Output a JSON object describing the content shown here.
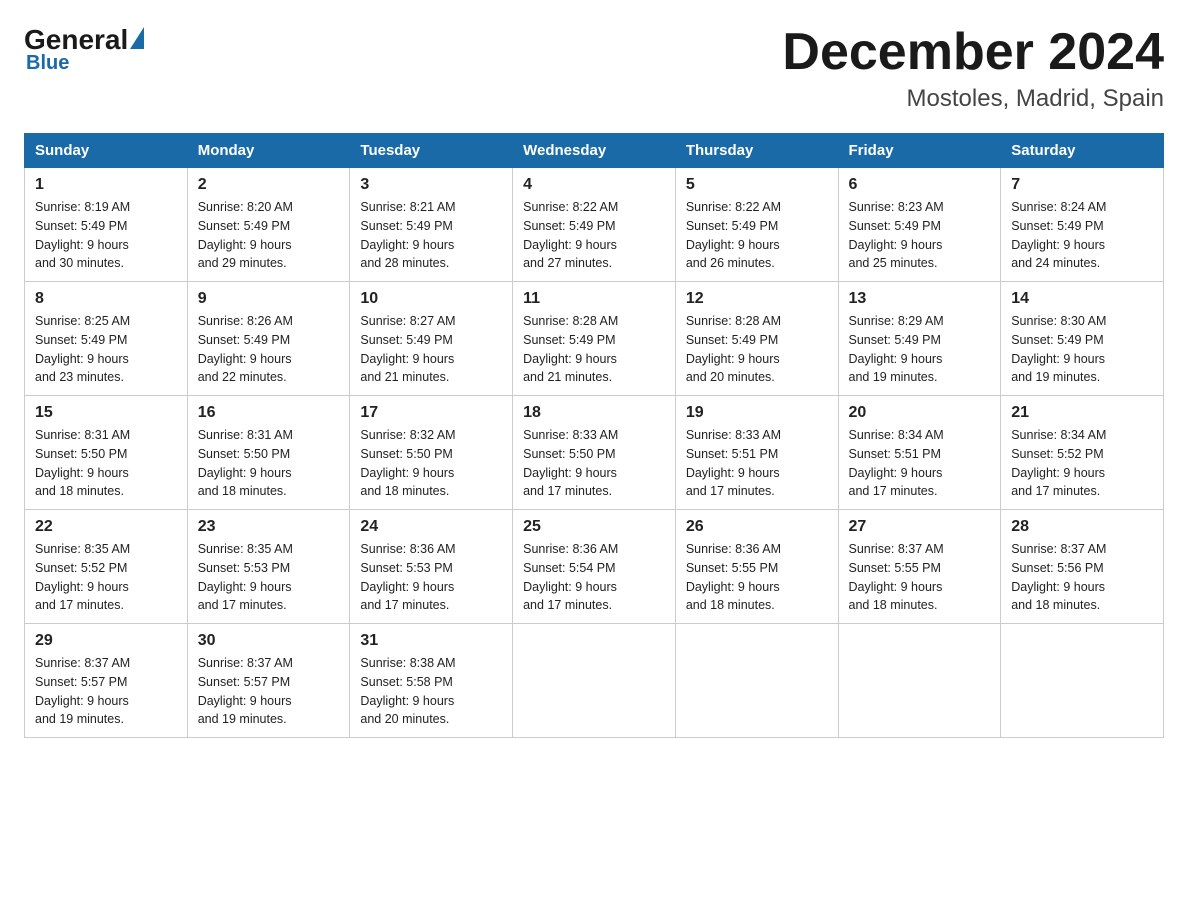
{
  "header": {
    "logo": {
      "general": "General",
      "blue": "Blue"
    },
    "title": "December 2024",
    "location": "Mostoles, Madrid, Spain"
  },
  "calendar": {
    "days_of_week": [
      "Sunday",
      "Monday",
      "Tuesday",
      "Wednesday",
      "Thursday",
      "Friday",
      "Saturday"
    ],
    "weeks": [
      [
        {
          "day": "1",
          "sunrise": "8:19 AM",
          "sunset": "5:49 PM",
          "daylight": "9 hours and 30 minutes."
        },
        {
          "day": "2",
          "sunrise": "8:20 AM",
          "sunset": "5:49 PM",
          "daylight": "9 hours and 29 minutes."
        },
        {
          "day": "3",
          "sunrise": "8:21 AM",
          "sunset": "5:49 PM",
          "daylight": "9 hours and 28 minutes."
        },
        {
          "day": "4",
          "sunrise": "8:22 AM",
          "sunset": "5:49 PM",
          "daylight": "9 hours and 27 minutes."
        },
        {
          "day": "5",
          "sunrise": "8:22 AM",
          "sunset": "5:49 PM",
          "daylight": "9 hours and 26 minutes."
        },
        {
          "day": "6",
          "sunrise": "8:23 AM",
          "sunset": "5:49 PM",
          "daylight": "9 hours and 25 minutes."
        },
        {
          "day": "7",
          "sunrise": "8:24 AM",
          "sunset": "5:49 PM",
          "daylight": "9 hours and 24 minutes."
        }
      ],
      [
        {
          "day": "8",
          "sunrise": "8:25 AM",
          "sunset": "5:49 PM",
          "daylight": "9 hours and 23 minutes."
        },
        {
          "day": "9",
          "sunrise": "8:26 AM",
          "sunset": "5:49 PM",
          "daylight": "9 hours and 22 minutes."
        },
        {
          "day": "10",
          "sunrise": "8:27 AM",
          "sunset": "5:49 PM",
          "daylight": "9 hours and 21 minutes."
        },
        {
          "day": "11",
          "sunrise": "8:28 AM",
          "sunset": "5:49 PM",
          "daylight": "9 hours and 21 minutes."
        },
        {
          "day": "12",
          "sunrise": "8:28 AM",
          "sunset": "5:49 PM",
          "daylight": "9 hours and 20 minutes."
        },
        {
          "day": "13",
          "sunrise": "8:29 AM",
          "sunset": "5:49 PM",
          "daylight": "9 hours and 19 minutes."
        },
        {
          "day": "14",
          "sunrise": "8:30 AM",
          "sunset": "5:49 PM",
          "daylight": "9 hours and 19 minutes."
        }
      ],
      [
        {
          "day": "15",
          "sunrise": "8:31 AM",
          "sunset": "5:50 PM",
          "daylight": "9 hours and 18 minutes."
        },
        {
          "day": "16",
          "sunrise": "8:31 AM",
          "sunset": "5:50 PM",
          "daylight": "9 hours and 18 minutes."
        },
        {
          "day": "17",
          "sunrise": "8:32 AM",
          "sunset": "5:50 PM",
          "daylight": "9 hours and 18 minutes."
        },
        {
          "day": "18",
          "sunrise": "8:33 AM",
          "sunset": "5:50 PM",
          "daylight": "9 hours and 17 minutes."
        },
        {
          "day": "19",
          "sunrise": "8:33 AM",
          "sunset": "5:51 PM",
          "daylight": "9 hours and 17 minutes."
        },
        {
          "day": "20",
          "sunrise": "8:34 AM",
          "sunset": "5:51 PM",
          "daylight": "9 hours and 17 minutes."
        },
        {
          "day": "21",
          "sunrise": "8:34 AM",
          "sunset": "5:52 PM",
          "daylight": "9 hours and 17 minutes."
        }
      ],
      [
        {
          "day": "22",
          "sunrise": "8:35 AM",
          "sunset": "5:52 PM",
          "daylight": "9 hours and 17 minutes."
        },
        {
          "day": "23",
          "sunrise": "8:35 AM",
          "sunset": "5:53 PM",
          "daylight": "9 hours and 17 minutes."
        },
        {
          "day": "24",
          "sunrise": "8:36 AM",
          "sunset": "5:53 PM",
          "daylight": "9 hours and 17 minutes."
        },
        {
          "day": "25",
          "sunrise": "8:36 AM",
          "sunset": "5:54 PM",
          "daylight": "9 hours and 17 minutes."
        },
        {
          "day": "26",
          "sunrise": "8:36 AM",
          "sunset": "5:55 PM",
          "daylight": "9 hours and 18 minutes."
        },
        {
          "day": "27",
          "sunrise": "8:37 AM",
          "sunset": "5:55 PM",
          "daylight": "9 hours and 18 minutes."
        },
        {
          "day": "28",
          "sunrise": "8:37 AM",
          "sunset": "5:56 PM",
          "daylight": "9 hours and 18 minutes."
        }
      ],
      [
        {
          "day": "29",
          "sunrise": "8:37 AM",
          "sunset": "5:57 PM",
          "daylight": "9 hours and 19 minutes."
        },
        {
          "day": "30",
          "sunrise": "8:37 AM",
          "sunset": "5:57 PM",
          "daylight": "9 hours and 19 minutes."
        },
        {
          "day": "31",
          "sunrise": "8:38 AM",
          "sunset": "5:58 PM",
          "daylight": "9 hours and 20 minutes."
        },
        null,
        null,
        null,
        null
      ]
    ],
    "labels": {
      "sunrise": "Sunrise:",
      "sunset": "Sunset:",
      "daylight": "Daylight:"
    }
  }
}
